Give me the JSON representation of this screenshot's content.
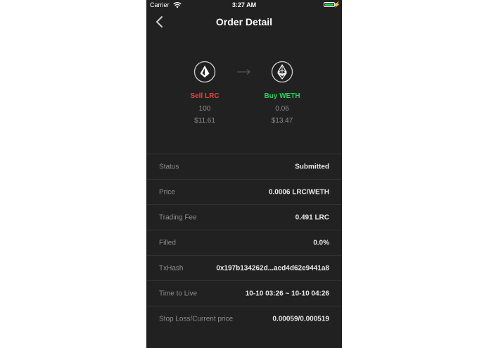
{
  "status_bar": {
    "carrier": "Carrier",
    "time": "3:27 AM"
  },
  "nav": {
    "title": "Order Detail",
    "back_icon": "chevron-left-icon"
  },
  "trade": {
    "sell": {
      "action": "Sell LRC",
      "amount": "100",
      "value": "$11.61",
      "icon": "lrc-token-icon",
      "color": "#e8453c"
    },
    "buy": {
      "action": "Buy WETH",
      "amount": "0.06",
      "value": "$13.47",
      "icon": "eth-token-icon",
      "color": "#2bd15c"
    },
    "arrow_icon": "arrow-right-icon"
  },
  "details": [
    {
      "label": "Status",
      "value": "Submitted"
    },
    {
      "label": "Price",
      "value": "0.0006 LRC/WETH"
    },
    {
      "label": "Trading Fee",
      "value": "0.491 LRC"
    },
    {
      "label": "Filled",
      "value": "0.0%"
    },
    {
      "label": "TxHash",
      "value": "0x197b134262d...acd4d62e9441a8"
    },
    {
      "label": "Time to Live",
      "value": "10-10 03:26 ~ 10-10 04:26"
    },
    {
      "label": "Stop Loss/Current price",
      "value": "0.00059/0.000519"
    }
  ],
  "colors": {
    "background": "#212121",
    "sell": "#e8453c",
    "buy": "#2bd15c",
    "battery": "#35d04e"
  }
}
